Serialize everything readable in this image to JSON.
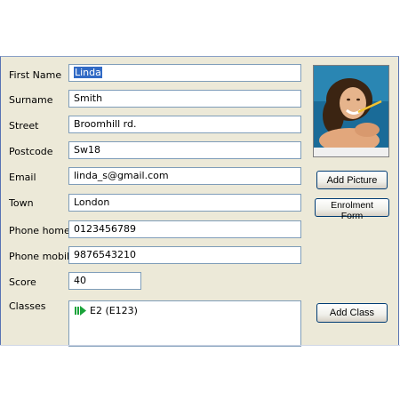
{
  "form": {
    "first_name": {
      "label": "First Name",
      "value": "Linda"
    },
    "surname": {
      "label": "Surname",
      "value": "Smith"
    },
    "street": {
      "label": "Street",
      "value": "Broomhill rd."
    },
    "postcode": {
      "label": "Postcode",
      "value": "Sw18"
    },
    "email": {
      "label": "Email",
      "value": "linda_s@gmail.com"
    },
    "town": {
      "label": "Town",
      "value": "London"
    },
    "phone_home": {
      "label": "Phone home",
      "value": "0123456789"
    },
    "phone_mobile": {
      "label": "Phone mobile",
      "value": "9876543210"
    },
    "score": {
      "label": "Score",
      "value": "40"
    },
    "classes": {
      "label": "Classes",
      "items": [
        {
          "text": "E2 (E123)",
          "icon": "arrow-icon"
        }
      ]
    }
  },
  "buttons": {
    "add_picture": "Add Picture",
    "enrolment_form": "Enrolment Form",
    "add_class": "Add Class"
  },
  "colors": {
    "window_bg": "#ece9d8",
    "selection": "#316ac5",
    "field_border": "#7f9db9",
    "class_icon": "#1aa33a"
  }
}
